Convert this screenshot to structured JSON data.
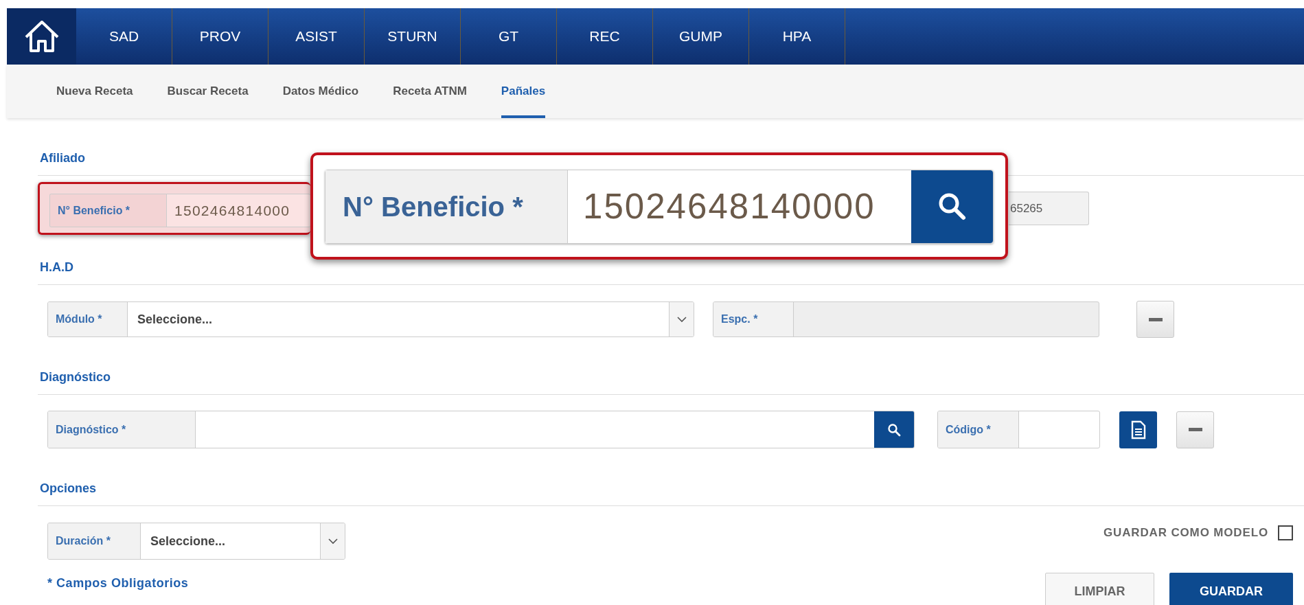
{
  "top_nav": {
    "tabs": [
      {
        "label": "SAD",
        "selected": false
      },
      {
        "label": "PROV",
        "selected": false
      },
      {
        "label": "ASIST",
        "selected": false
      },
      {
        "label": "STURN",
        "selected": false
      },
      {
        "label": "GT",
        "selected": false
      },
      {
        "label": "REC",
        "selected": false
      },
      {
        "label": "GUMP",
        "selected": false
      },
      {
        "label": "HPA",
        "selected": false
      }
    ]
  },
  "sub_nav": {
    "tabs": [
      {
        "label": "Nueva Receta",
        "selected": false
      },
      {
        "label": "Buscar Receta",
        "selected": false
      },
      {
        "label": "Datos Médico",
        "selected": false
      },
      {
        "label": "Receta ATNM",
        "selected": false
      },
      {
        "label": "Pañales",
        "selected": true
      }
    ]
  },
  "afiliado": {
    "title": "Afiliado",
    "beneficio": {
      "label": "N° Beneficio *",
      "value": "1502464814000",
      "highlighted": true
    },
    "field_2": {
      "value": "65265"
    }
  },
  "callout": {
    "label": "N° Beneficio *",
    "value": "15024648140000"
  },
  "had": {
    "title": "H.A.D",
    "modulo": {
      "label": "Módulo *",
      "value": "Seleccione..."
    },
    "espc": {
      "label": "Espc. *",
      "disabled": true
    }
  },
  "diagnostico": {
    "title": "Diagnóstico",
    "diagnostico": {
      "label": "Diagnóstico *"
    },
    "codigo": {
      "label": "Código *"
    }
  },
  "opciones": {
    "title": "Opciones",
    "duracion": {
      "label": "Duración *",
      "value": "Seleccione..."
    },
    "guardar_como_modelo": {
      "label": "GUARDAR COMO MODELO",
      "checked": false
    }
  },
  "required_note": "* Campos Obligatorios",
  "buttons": [
    {
      "label": "LIMPIAR",
      "kind": "secondary"
    },
    {
      "label": "GUARDAR",
      "kind": "primary"
    }
  ]
}
